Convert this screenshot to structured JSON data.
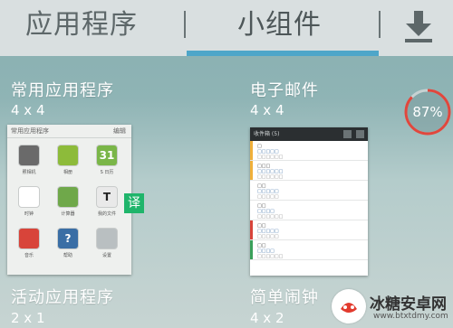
{
  "tabs": {
    "apps_label": "应用程序",
    "widgets_label": "小组件",
    "active": "小组件",
    "accent_color": "#4ea6c9"
  },
  "toolbar": {
    "download_icon": "download-icon"
  },
  "widgets": [
    {
      "title": "常用应用程序",
      "size": "4 x 4"
    },
    {
      "title": "电子邮件",
      "size": "4 x 4"
    },
    {
      "title": "活动应用程序",
      "size": "2 x 1"
    },
    {
      "title": "简单闹钟",
      "size": "4 x 2"
    }
  ],
  "frequent_apps_preview": {
    "header": "常用应用程序",
    "edit": "编辑",
    "apps": [
      {
        "label": "照相机",
        "icon": "camera-icon",
        "color": "#6a6a6a"
      },
      {
        "label": "相册",
        "icon": "gallery-icon",
        "color": "#8dbb3a"
      },
      {
        "label": "S 日历",
        "icon": "calendar-icon",
        "color": "#7ab648",
        "text": "31"
      },
      {
        "label": "时钟",
        "icon": "clock-icon",
        "color": "#ffffff"
      },
      {
        "label": "计算器",
        "icon": "calculator-icon",
        "color": "#6fa84a"
      },
      {
        "label": "我的文件",
        "icon": "text-icon",
        "color": "#e9e9e9",
        "text": "T"
      },
      {
        "label": "音乐",
        "icon": "music-icon",
        "color": "#d8443a"
      },
      {
        "label": "帮助",
        "icon": "help-icon",
        "color": "#3a6ea5",
        "text": "?"
      },
      {
        "label": "设置",
        "icon": "settings-icon",
        "color": "#b9bfc1"
      }
    ]
  },
  "email_preview": {
    "header": "收件箱 (5)",
    "mails": [
      {
        "sender": "□",
        "subject": "□□□□□",
        "preview": "□□□□□□",
        "bar": "#f0b03a"
      },
      {
        "sender": "□□□",
        "subject": "□□□□□□",
        "preview": "□□□□□□",
        "bar": "#f0b03a"
      },
      {
        "sender": "□□",
        "subject": "□□□□□",
        "preview": "□□□□□",
        "bar": "#ffffff"
      },
      {
        "sender": "□□",
        "subject": "□□□□",
        "preview": "□□□□□□",
        "bar": "#ffffff"
      },
      {
        "sender": "□□",
        "subject": "□□□□□",
        "preview": "□□□□□",
        "bar": "#d8443a"
      },
      {
        "sender": "□□",
        "subject": "□□□□",
        "preview": "□□□□□□",
        "bar": "#3aa05a"
      }
    ]
  },
  "translate_badge": {
    "text": "译",
    "color": "#1fb56b"
  },
  "memory_ring": {
    "percent": 87,
    "label": "87%",
    "color": "#e0473d"
  },
  "watermark": {
    "title": "冰糖安卓网",
    "url": "www.btxtdmy.com"
  }
}
